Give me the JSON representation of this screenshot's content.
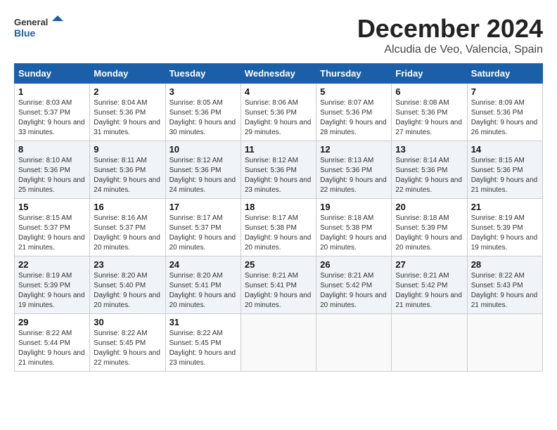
{
  "header": {
    "logo_general": "General",
    "logo_blue": "Blue",
    "month_title": "December 2024",
    "location": "Alcudia de Veo, Valencia, Spain"
  },
  "calendar": {
    "days_of_week": [
      "Sunday",
      "Monday",
      "Tuesday",
      "Wednesday",
      "Thursday",
      "Friday",
      "Saturday"
    ],
    "weeks": [
      [
        {
          "day": "1",
          "sunrise": "Sunrise: 8:03 AM",
          "sunset": "Sunset: 5:37 PM",
          "daylight": "Daylight: 9 hours and 33 minutes."
        },
        {
          "day": "2",
          "sunrise": "Sunrise: 8:04 AM",
          "sunset": "Sunset: 5:36 PM",
          "daylight": "Daylight: 9 hours and 31 minutes."
        },
        {
          "day": "3",
          "sunrise": "Sunrise: 8:05 AM",
          "sunset": "Sunset: 5:36 PM",
          "daylight": "Daylight: 9 hours and 30 minutes."
        },
        {
          "day": "4",
          "sunrise": "Sunrise: 8:06 AM",
          "sunset": "Sunset: 5:36 PM",
          "daylight": "Daylight: 9 hours and 29 minutes."
        },
        {
          "day": "5",
          "sunrise": "Sunrise: 8:07 AM",
          "sunset": "Sunset: 5:36 PM",
          "daylight": "Daylight: 9 hours and 28 minutes."
        },
        {
          "day": "6",
          "sunrise": "Sunrise: 8:08 AM",
          "sunset": "Sunset: 5:36 PM",
          "daylight": "Daylight: 9 hours and 27 minutes."
        },
        {
          "day": "7",
          "sunrise": "Sunrise: 8:09 AM",
          "sunset": "Sunset: 5:36 PM",
          "daylight": "Daylight: 9 hours and 26 minutes."
        }
      ],
      [
        {
          "day": "8",
          "sunrise": "Sunrise: 8:10 AM",
          "sunset": "Sunset: 5:36 PM",
          "daylight": "Daylight: 9 hours and 25 minutes."
        },
        {
          "day": "9",
          "sunrise": "Sunrise: 8:11 AM",
          "sunset": "Sunset: 5:36 PM",
          "daylight": "Daylight: 9 hours and 24 minutes."
        },
        {
          "day": "10",
          "sunrise": "Sunrise: 8:12 AM",
          "sunset": "Sunset: 5:36 PM",
          "daylight": "Daylight: 9 hours and 24 minutes."
        },
        {
          "day": "11",
          "sunrise": "Sunrise: 8:12 AM",
          "sunset": "Sunset: 5:36 PM",
          "daylight": "Daylight: 9 hours and 23 minutes."
        },
        {
          "day": "12",
          "sunrise": "Sunrise: 8:13 AM",
          "sunset": "Sunset: 5:36 PM",
          "daylight": "Daylight: 9 hours and 22 minutes."
        },
        {
          "day": "13",
          "sunrise": "Sunrise: 8:14 AM",
          "sunset": "Sunset: 5:36 PM",
          "daylight": "Daylight: 9 hours and 22 minutes."
        },
        {
          "day": "14",
          "sunrise": "Sunrise: 8:15 AM",
          "sunset": "Sunset: 5:36 PM",
          "daylight": "Daylight: 9 hours and 21 minutes."
        }
      ],
      [
        {
          "day": "15",
          "sunrise": "Sunrise: 8:15 AM",
          "sunset": "Sunset: 5:37 PM",
          "daylight": "Daylight: 9 hours and 21 minutes."
        },
        {
          "day": "16",
          "sunrise": "Sunrise: 8:16 AM",
          "sunset": "Sunset: 5:37 PM",
          "daylight": "Daylight: 9 hours and 20 minutes."
        },
        {
          "day": "17",
          "sunrise": "Sunrise: 8:17 AM",
          "sunset": "Sunset: 5:37 PM",
          "daylight": "Daylight: 9 hours and 20 minutes."
        },
        {
          "day": "18",
          "sunrise": "Sunrise: 8:17 AM",
          "sunset": "Sunset: 5:38 PM",
          "daylight": "Daylight: 9 hours and 20 minutes."
        },
        {
          "day": "19",
          "sunrise": "Sunrise: 8:18 AM",
          "sunset": "Sunset: 5:38 PM",
          "daylight": "Daylight: 9 hours and 20 minutes."
        },
        {
          "day": "20",
          "sunrise": "Sunrise: 8:18 AM",
          "sunset": "Sunset: 5:39 PM",
          "daylight": "Daylight: 9 hours and 20 minutes."
        },
        {
          "day": "21",
          "sunrise": "Sunrise: 8:19 AM",
          "sunset": "Sunset: 5:39 PM",
          "daylight": "Daylight: 9 hours and 19 minutes."
        }
      ],
      [
        {
          "day": "22",
          "sunrise": "Sunrise: 8:19 AM",
          "sunset": "Sunset: 5:39 PM",
          "daylight": "Daylight: 9 hours and 19 minutes."
        },
        {
          "day": "23",
          "sunrise": "Sunrise: 8:20 AM",
          "sunset": "Sunset: 5:40 PM",
          "daylight": "Daylight: 9 hours and 20 minutes."
        },
        {
          "day": "24",
          "sunrise": "Sunrise: 8:20 AM",
          "sunset": "Sunset: 5:41 PM",
          "daylight": "Daylight: 9 hours and 20 minutes."
        },
        {
          "day": "25",
          "sunrise": "Sunrise: 8:21 AM",
          "sunset": "Sunset: 5:41 PM",
          "daylight": "Daylight: 9 hours and 20 minutes."
        },
        {
          "day": "26",
          "sunrise": "Sunrise: 8:21 AM",
          "sunset": "Sunset: 5:42 PM",
          "daylight": "Daylight: 9 hours and 20 minutes."
        },
        {
          "day": "27",
          "sunrise": "Sunrise: 8:21 AM",
          "sunset": "Sunset: 5:42 PM",
          "daylight": "Daylight: 9 hours and 21 minutes."
        },
        {
          "day": "28",
          "sunrise": "Sunrise: 8:22 AM",
          "sunset": "Sunset: 5:43 PM",
          "daylight": "Daylight: 9 hours and 21 minutes."
        }
      ],
      [
        {
          "day": "29",
          "sunrise": "Sunrise: 8:22 AM",
          "sunset": "Sunset: 5:44 PM",
          "daylight": "Daylight: 9 hours and 21 minutes."
        },
        {
          "day": "30",
          "sunrise": "Sunrise: 8:22 AM",
          "sunset": "Sunset: 5:45 PM",
          "daylight": "Daylight: 9 hours and 22 minutes."
        },
        {
          "day": "31",
          "sunrise": "Sunrise: 8:22 AM",
          "sunset": "Sunset: 5:45 PM",
          "daylight": "Daylight: 9 hours and 23 minutes."
        },
        null,
        null,
        null,
        null
      ]
    ]
  }
}
